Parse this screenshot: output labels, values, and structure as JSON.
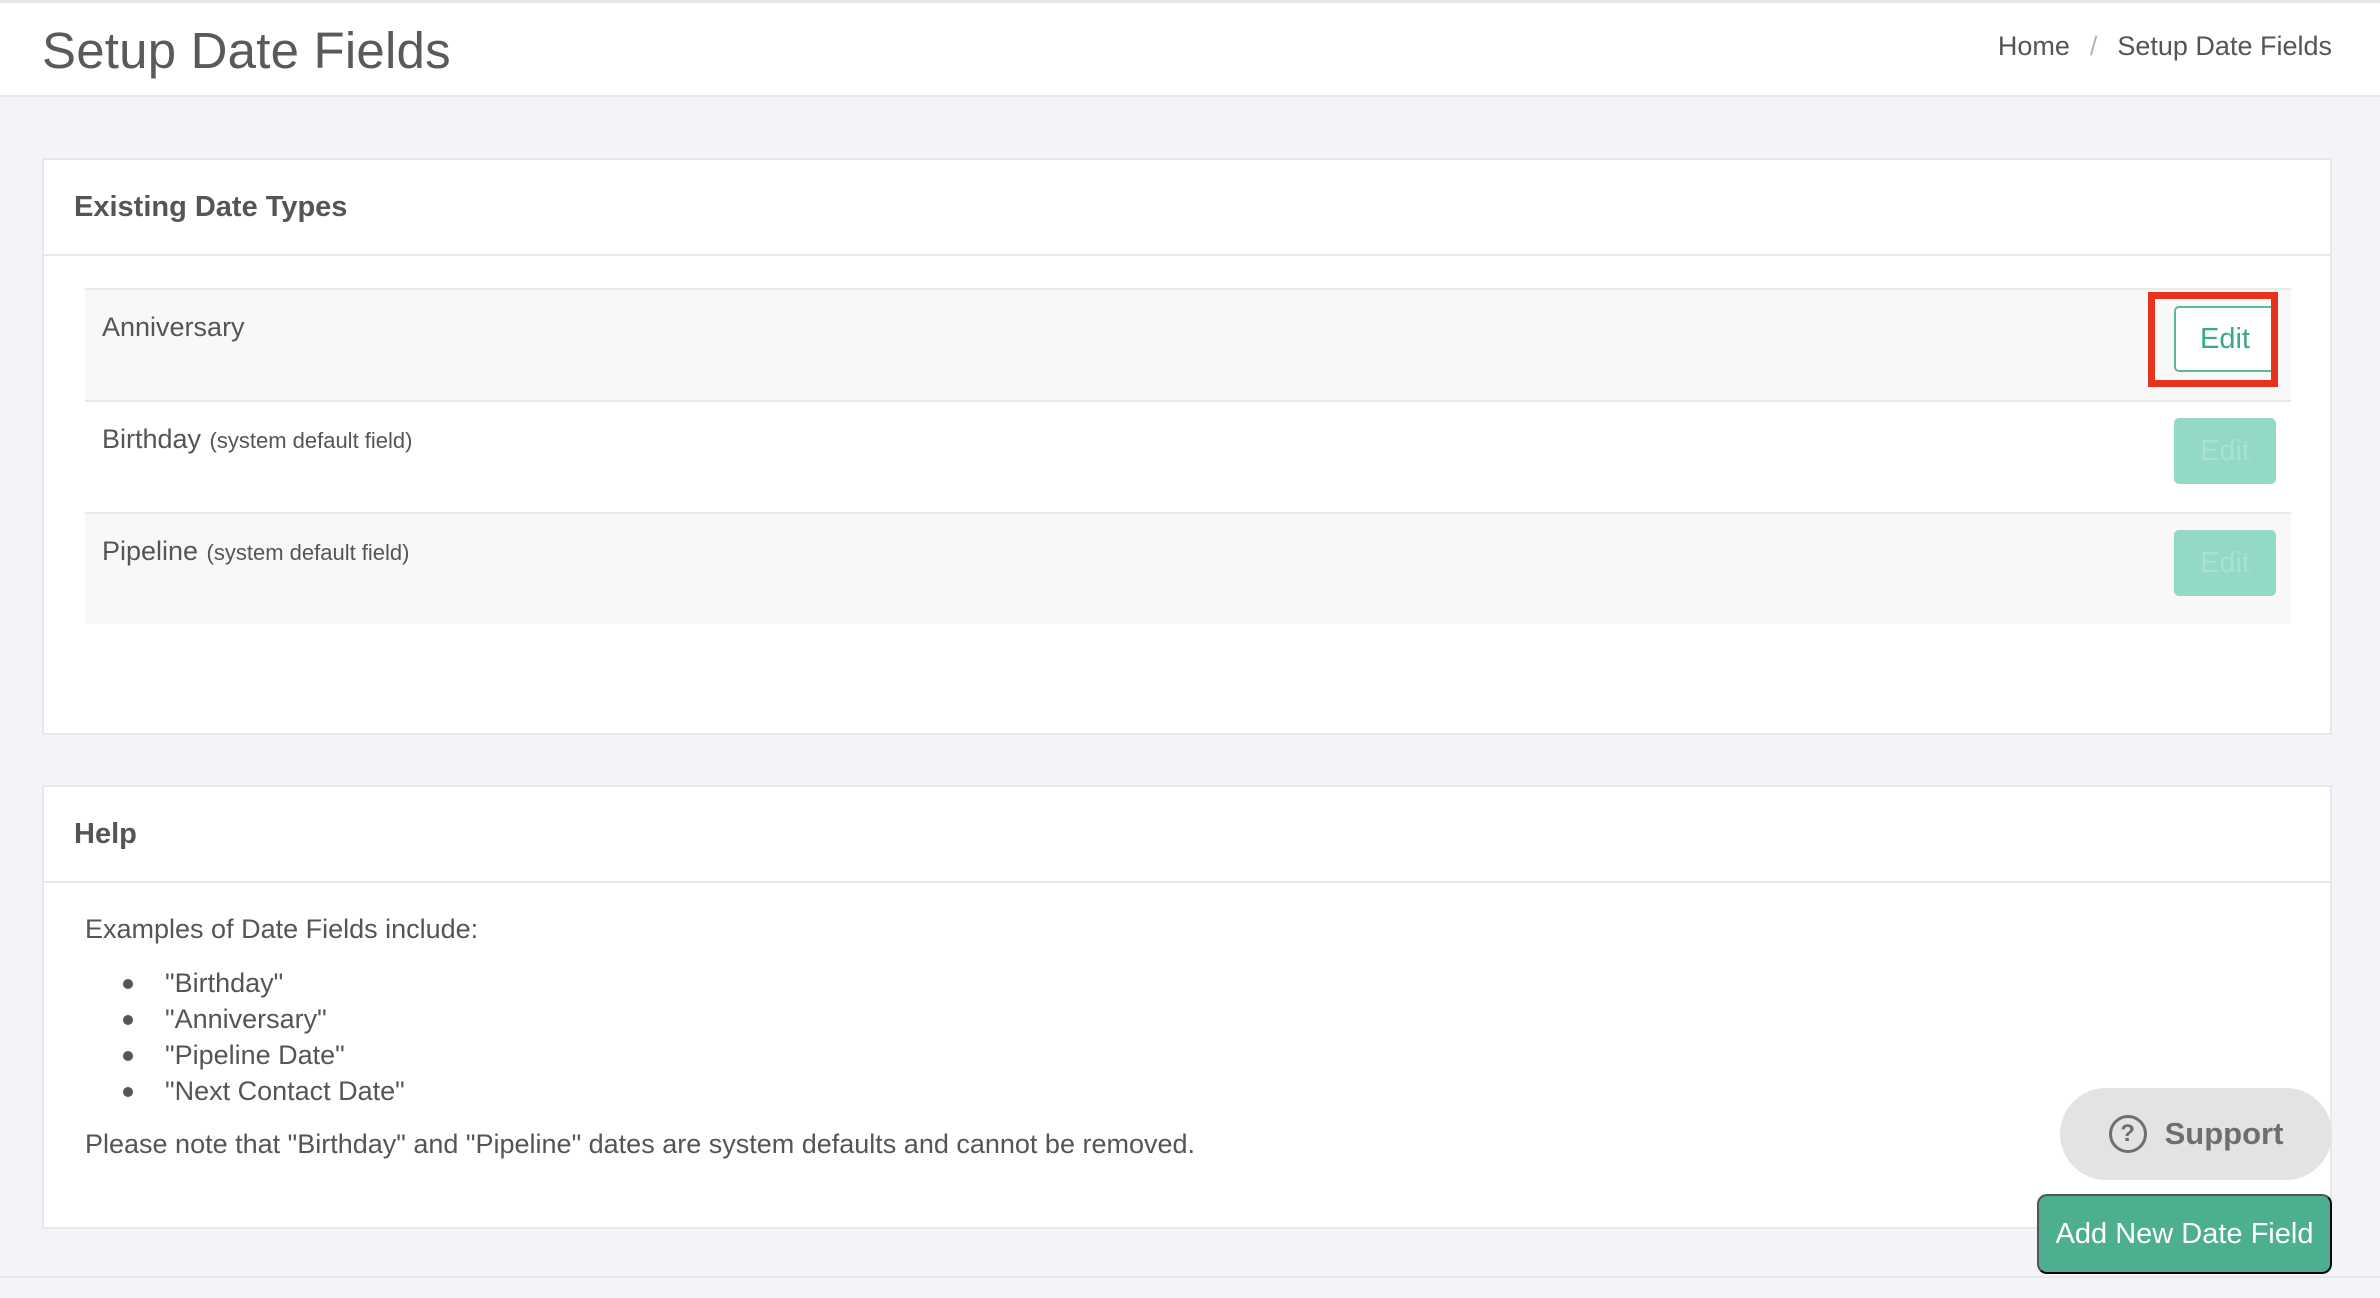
{
  "header": {
    "title": "Setup Date Fields",
    "breadcrumb": {
      "home": "Home",
      "separator": "/",
      "current": "Setup Date Fields"
    }
  },
  "existing_types": {
    "heading": "Existing Date Types",
    "rows": [
      {
        "name": "Anniversary",
        "note": "",
        "edit_label": "Edit"
      },
      {
        "name": "Birthday",
        "note": "(system default field)",
        "edit_label": "Edit"
      },
      {
        "name": "Pipeline",
        "note": "(system default field)",
        "edit_label": "Edit"
      }
    ]
  },
  "help": {
    "heading": "Help",
    "intro": "Examples of Date Fields include:",
    "examples": [
      "\"Birthday\"",
      "\"Anniversary\"",
      "\"Pipeline Date\"",
      "\"Next Contact Date\""
    ],
    "note": "Please note that \"Birthday\" and \"Pipeline\" dates are system defaults and cannot be removed."
  },
  "support": {
    "label": "Support",
    "icon": "question-circle-icon"
  },
  "add_button": {
    "label": "Add New Date Field"
  },
  "colors": {
    "accent": "#4caf8f",
    "highlight": "#e8331c",
    "disabled_button": "#94d8c6"
  }
}
